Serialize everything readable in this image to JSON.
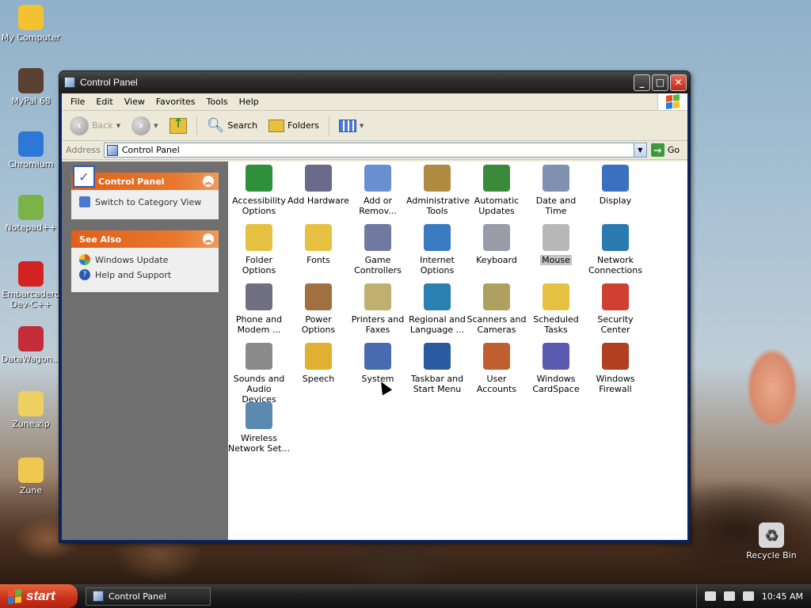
{
  "desktop": {
    "icons": [
      {
        "label": "My Computer",
        "icon": "my-computer-icon",
        "color": "#f2c230"
      },
      {
        "label": "MyPal 68",
        "icon": "mypal-icon",
        "color": "#5a4030"
      },
      {
        "label": "Chromium",
        "icon": "chromium-icon",
        "color": "#2d78d6"
      },
      {
        "label": "Notepad++",
        "icon": "notepad-plus-plus-icon",
        "color": "#7bb34a"
      },
      {
        "label": "Embarcadero Dev-C++",
        "icon": "devcpp-icon",
        "color": "#d32222"
      },
      {
        "label": "DataWagon...",
        "icon": "datawagon-icon",
        "color": "#c42c3a"
      },
      {
        "label": "Zune.zip",
        "icon": "zip-folder-icon",
        "color": "#f0d060"
      },
      {
        "label": "Zune",
        "icon": "folder-icon",
        "color": "#f0c850"
      }
    ],
    "recycle_bin": "Recycle Bin"
  },
  "window": {
    "title": "Control Panel",
    "buttons": {
      "minimize": "_",
      "maximize": "□",
      "close": "✕"
    }
  },
  "menu": [
    "File",
    "Edit",
    "View",
    "Favorites",
    "Tools",
    "Help"
  ],
  "toolbar": {
    "back": "Back",
    "search": "Search",
    "folders": "Folders"
  },
  "address": {
    "label": "Address",
    "value": "Control Panel",
    "go": "Go"
  },
  "taskpane": {
    "control_panel": {
      "title": "Control Panel",
      "link": "Switch to Category View"
    },
    "see_also": {
      "title": "See Also",
      "links": [
        "Windows Update",
        "Help and Support"
      ]
    }
  },
  "items": [
    {
      "label": "Accessibility Options",
      "icon": "accessibility-icon",
      "color": "#2f8f3a"
    },
    {
      "label": "Add Hardware",
      "icon": "add-hardware-icon",
      "color": "#6a6a8a"
    },
    {
      "label": "Add or Remov...",
      "icon": "add-remove-programs-icon",
      "color": "#6a8fd0"
    },
    {
      "label": "Administrative Tools",
      "icon": "administrative-tools-icon",
      "color": "#b08a40"
    },
    {
      "label": "Automatic Updates",
      "icon": "automatic-updates-icon",
      "color": "#3a8a3a"
    },
    {
      "label": "Date and Time",
      "icon": "date-time-icon",
      "color": "#8090b0"
    },
    {
      "label": "Display",
      "icon": "display-icon",
      "color": "#3a70c0"
    },
    {
      "label": "Folder Options",
      "icon": "folder-options-icon",
      "color": "#e6c040"
    },
    {
      "label": "Fonts",
      "icon": "fonts-icon",
      "color": "#e6c040"
    },
    {
      "label": "Game Controllers",
      "icon": "game-controllers-icon",
      "color": "#707aa0"
    },
    {
      "label": "Internet Options",
      "icon": "internet-options-icon",
      "color": "#3a7ac0"
    },
    {
      "label": "Keyboard",
      "icon": "keyboard-icon",
      "color": "#9a9aa8"
    },
    {
      "label": "Mouse",
      "icon": "mouse-icon",
      "color": "#b8b8b8",
      "selected": true
    },
    {
      "label": "Network Connections",
      "icon": "network-connections-icon",
      "color": "#2a7ab0"
    },
    {
      "label": "Phone and Modem ...",
      "icon": "phone-modem-icon",
      "color": "#707080"
    },
    {
      "label": "Power Options",
      "icon": "power-options-icon",
      "color": "#a07040"
    },
    {
      "label": "Printers and Faxes",
      "icon": "printers-faxes-icon",
      "color": "#c0b070"
    },
    {
      "label": "Regional and Language ...",
      "icon": "regional-language-icon",
      "color": "#2a80b0"
    },
    {
      "label": "Scanners and Cameras",
      "icon": "scanners-cameras-icon",
      "color": "#b0a060"
    },
    {
      "label": "Scheduled Tasks",
      "icon": "scheduled-tasks-icon",
      "color": "#e6c040"
    },
    {
      "label": "Security Center",
      "icon": "security-center-icon",
      "color": "#d04030"
    },
    {
      "label": "Sounds and Audio Devices",
      "icon": "sounds-audio-icon",
      "color": "#8a8a8a"
    },
    {
      "label": "Speech",
      "icon": "speech-icon",
      "color": "#e0b030"
    },
    {
      "label": "System",
      "icon": "system-icon",
      "color": "#4a6ab0"
    },
    {
      "label": "Taskbar and Start Menu",
      "icon": "taskbar-start-menu-icon",
      "color": "#2a5aa0"
    },
    {
      "label": "User Accounts",
      "icon": "user-accounts-icon",
      "color": "#c06030"
    },
    {
      "label": "Windows CardSpace",
      "icon": "cardspace-icon",
      "color": "#5a5ab0"
    },
    {
      "label": "Windows Firewall",
      "icon": "firewall-icon",
      "color": "#b04020"
    },
    {
      "label": "Wireless Network Set...",
      "icon": "wireless-network-icon",
      "color": "#5a8ab0"
    }
  ],
  "taskbar": {
    "start": "start",
    "task": "Control Panel",
    "clock": "10:45 AM"
  }
}
